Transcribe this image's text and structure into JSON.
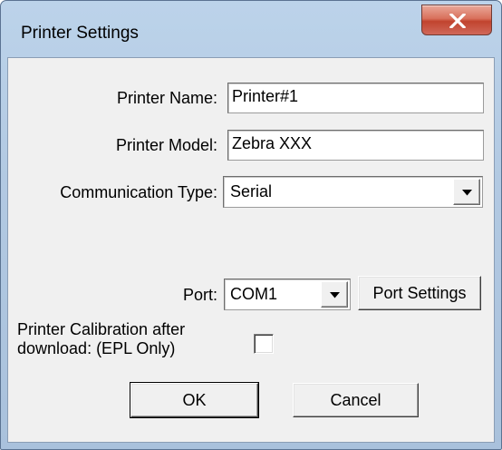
{
  "window": {
    "title": "Printer Settings"
  },
  "form": {
    "printer_name_label": "Printer Name:",
    "printer_name_value": "Printer#1",
    "printer_model_label": "Printer Model:",
    "printer_model_value": "Zebra XXX",
    "communication_type_label": "Communication Type:",
    "communication_type_value": "Serial",
    "port_label": "Port:",
    "port_value": "COM1",
    "port_settings_button": "Port Settings",
    "calibration_label_line1": "Printer Calibration after",
    "calibration_label_line2": "download: (EPL Only)",
    "calibration_checked": false
  },
  "buttons": {
    "ok": "OK",
    "cancel": "Cancel"
  },
  "icons": {
    "close": "close-icon",
    "dropdown": "chevron-down-icon"
  },
  "colors": {
    "frame": "#b2c9e2",
    "client": "#f0f0f0",
    "close_button": "#c1442e"
  }
}
